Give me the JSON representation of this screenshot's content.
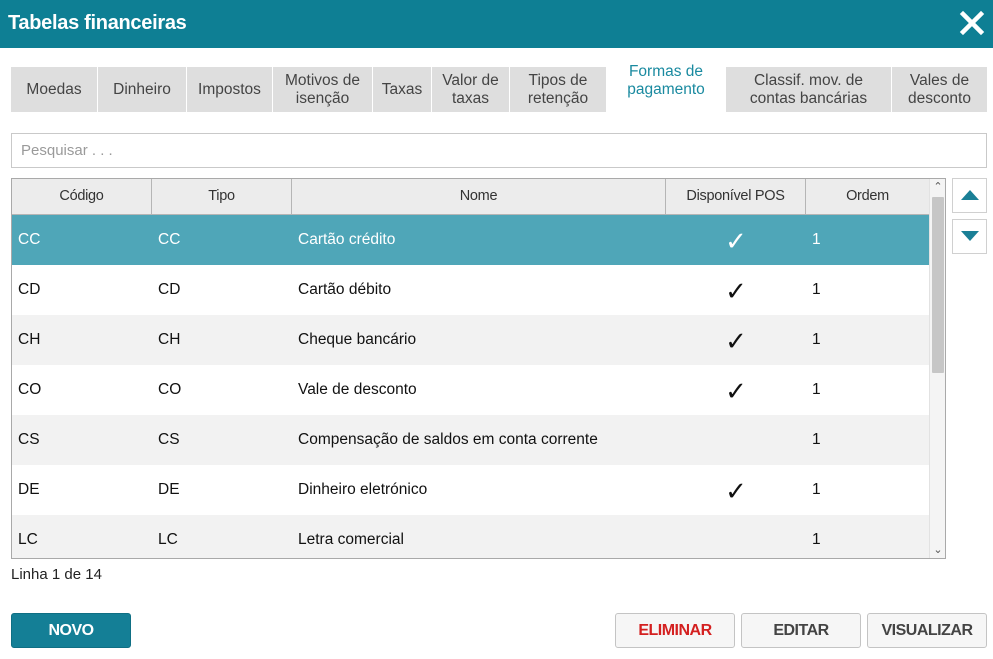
{
  "window": {
    "title": "Tabelas financeiras",
    "close_icon": "close-icon"
  },
  "tabs": [
    {
      "line1": "Moedas",
      "line2": ""
    },
    {
      "line1": "Dinheiro",
      "line2": ""
    },
    {
      "line1": "Impostos",
      "line2": ""
    },
    {
      "line1": "Motivos de",
      "line2": "isenção"
    },
    {
      "line1": "Taxas",
      "line2": ""
    },
    {
      "line1": "Valor de",
      "line2": "taxas"
    },
    {
      "line1": "Tipos de",
      "line2": "retenção"
    },
    {
      "line1": "Formas de",
      "line2": "pagamento",
      "active": true
    },
    {
      "line1": "Classif. mov. de",
      "line2": "contas bancárias"
    },
    {
      "line1": "Vales de",
      "line2": "desconto"
    }
  ],
  "search": {
    "placeholder": "Pesquisar . . .",
    "value": ""
  },
  "table": {
    "columns": [
      "Código",
      "Tipo",
      "Nome",
      "Disponível POS",
      "Ordem"
    ],
    "rows": [
      {
        "codigo": "CC",
        "tipo": "CC",
        "nome": "Cartão crédito",
        "pos": "✓",
        "ordem": "1",
        "selected": true
      },
      {
        "codigo": "CD",
        "tipo": "CD",
        "nome": "Cartão débito",
        "pos": "✓",
        "ordem": "1"
      },
      {
        "codigo": "CH",
        "tipo": "CH",
        "nome": "Cheque bancário",
        "pos": "✓",
        "ordem": "1"
      },
      {
        "codigo": "CO",
        "tipo": "CO",
        "nome": "Vale de desconto",
        "pos": "✓",
        "ordem": "1"
      },
      {
        "codigo": "CS",
        "tipo": "CS",
        "nome": "Compensação de saldos em conta corrente",
        "pos": "",
        "ordem": "1"
      },
      {
        "codigo": "DE",
        "tipo": "DE",
        "nome": "Dinheiro eletrónico",
        "pos": "✓",
        "ordem": "1"
      },
      {
        "codigo": "LC",
        "tipo": "LC",
        "nome": "Letra comercial",
        "pos": "",
        "ordem": "1"
      }
    ]
  },
  "status": {
    "text": "Linha 1 de 14"
  },
  "buttons": {
    "novo": "NOVO",
    "eliminar": "ELIMINAR",
    "editar": "EDITAR",
    "visualizar": "VISUALIZAR",
    "move_up_icon": "triangle-up-icon",
    "move_down_icon": "triangle-down-icon"
  },
  "colors": {
    "header": "#0e7f94",
    "selected_row": "#4fa6b8",
    "active_tab_text": "#1a8aa0",
    "primary_button": "#147f96",
    "danger_text": "#d42020"
  }
}
